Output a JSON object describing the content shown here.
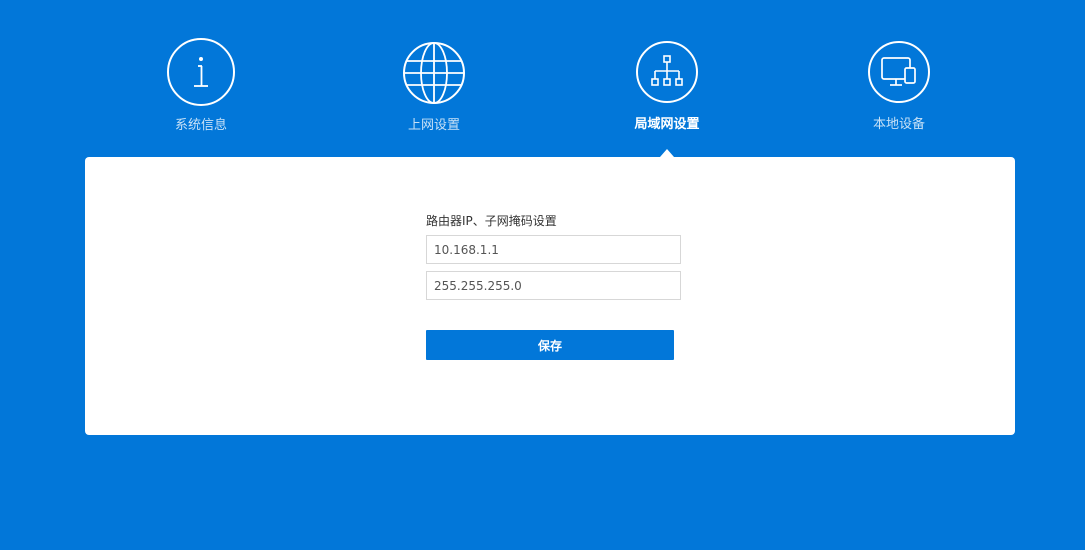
{
  "nav": {
    "items": [
      {
        "label": "系统信息",
        "icon": "info-icon",
        "active": false
      },
      {
        "label": "上网设置",
        "icon": "globe-icon",
        "active": false
      },
      {
        "label": "局域网设置",
        "icon": "network-tree-icon",
        "active": true
      },
      {
        "label": "本地设备",
        "icon": "devices-icon",
        "active": false
      }
    ]
  },
  "lan_form": {
    "title": "路由器IP、子网掩码设置",
    "router_ip": "10.168.1.1",
    "subnet_mask": "255.255.255.0",
    "save_label": "保存"
  },
  "colors": {
    "background": "#0277d9",
    "panel": "#ffffff",
    "accent": "#0277d9"
  }
}
